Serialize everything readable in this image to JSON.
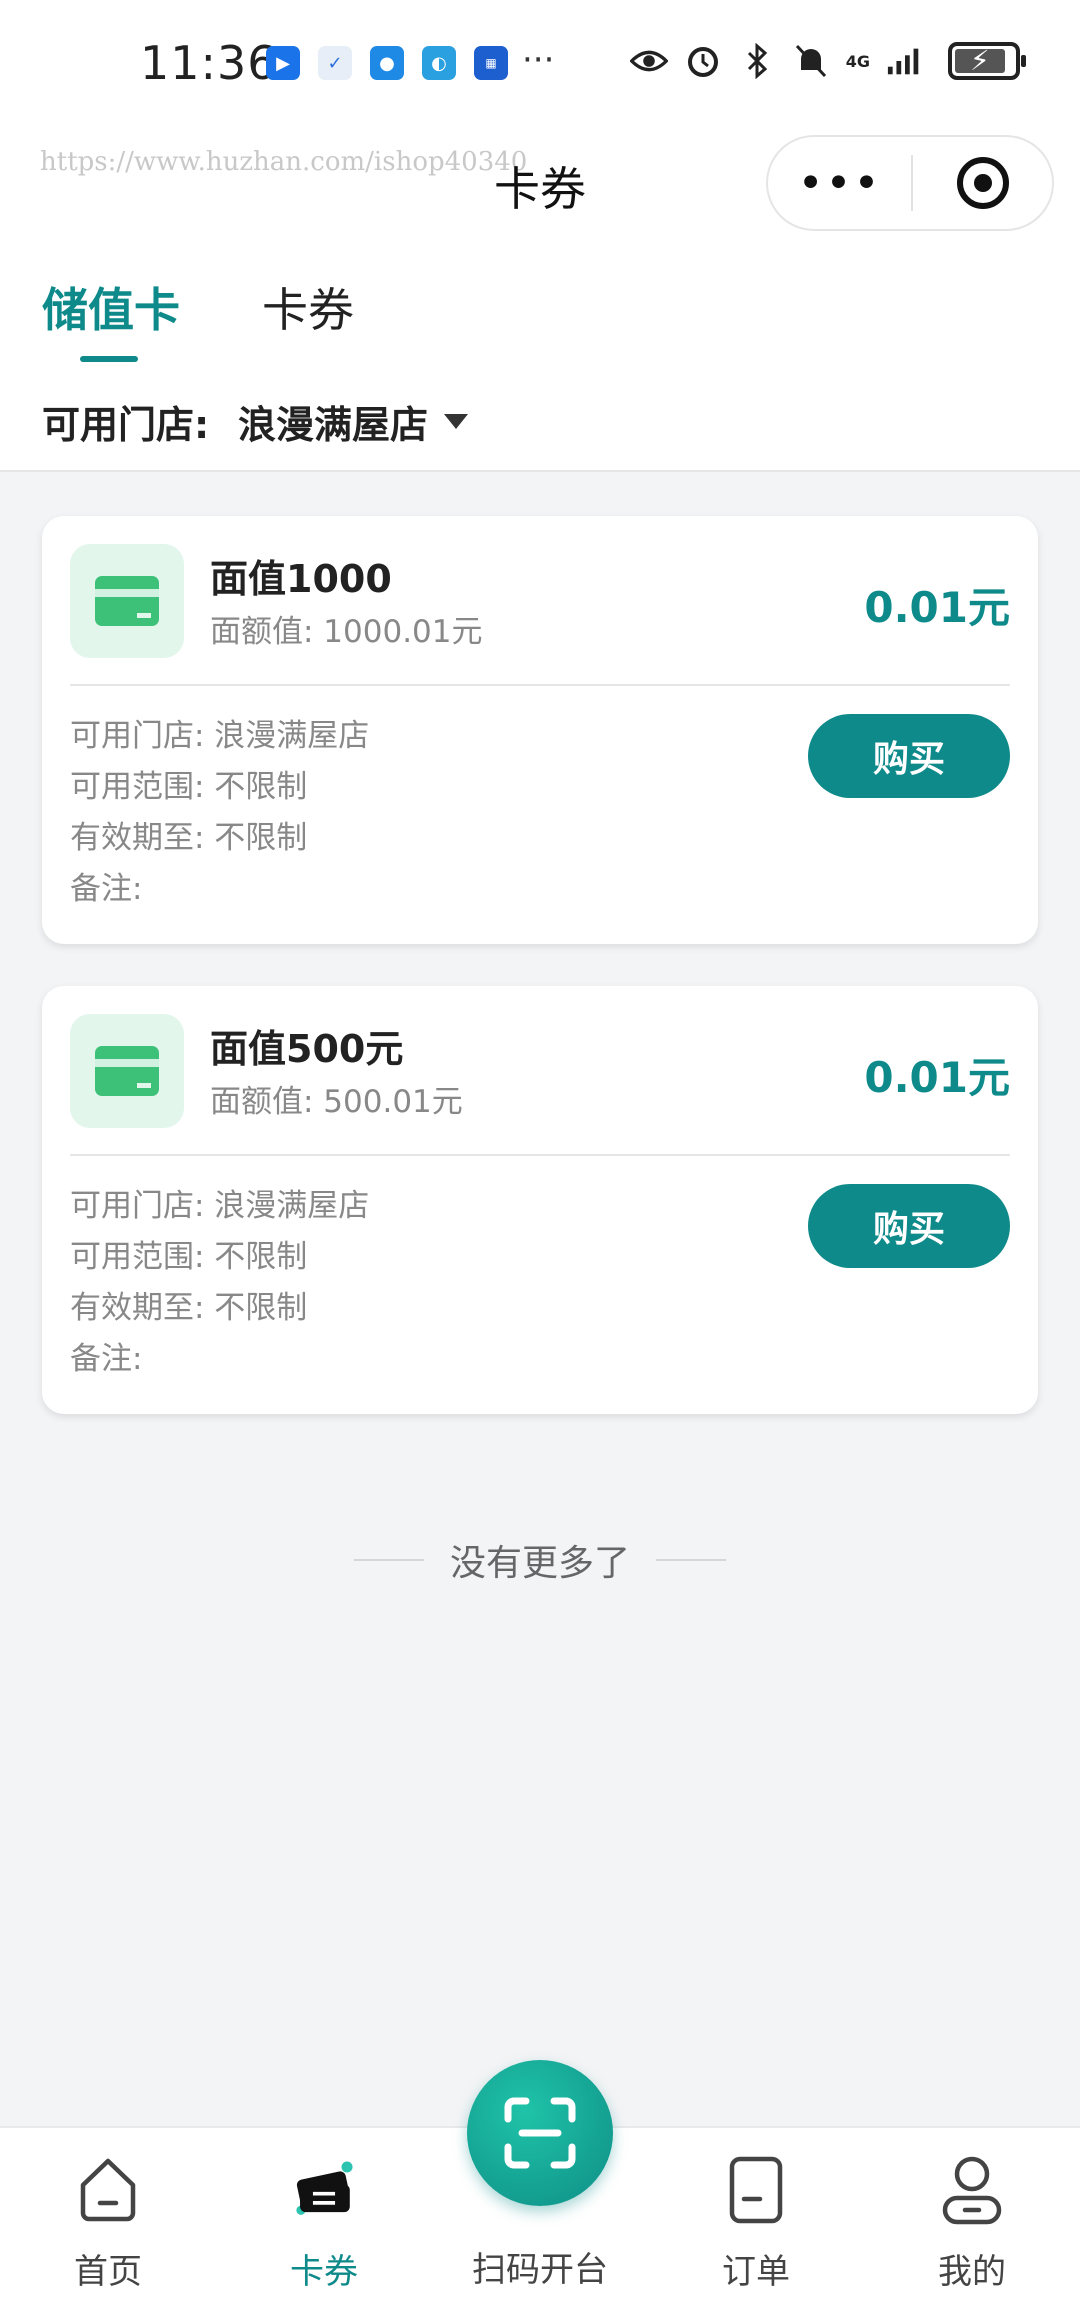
{
  "status_bar": {
    "time": "11:36",
    "more": "···",
    "network": "4G"
  },
  "header": {
    "watermark": "https://www.huzhan.com/ishop40340",
    "title": "卡券",
    "capsule_more": "•••"
  },
  "tabs": [
    {
      "label": "储值卡",
      "active": true
    },
    {
      "label": "卡券",
      "active": false
    }
  ],
  "store_filter": {
    "label": "可用门店:",
    "value": "浪漫满屋店"
  },
  "cards": [
    {
      "name": "面值1000",
      "face_value": "面额值: 1000.01元",
      "price": "0.01元",
      "store": "可用门店: 浪漫满屋店",
      "scope": "可用范围: 不限制",
      "expiry": "有效期至: 不限制",
      "note": "备注:",
      "buy_label": "购买"
    },
    {
      "name": "面值500元",
      "face_value": "面额值: 500.01元",
      "price": "0.01元",
      "store": "可用门店: 浪漫满屋店",
      "scope": "可用范围: 不限制",
      "expiry": "有效期至: 不限制",
      "note": "备注:",
      "buy_label": "购买"
    }
  ],
  "list_end": "没有更多了",
  "tabbar": {
    "home": "首页",
    "coupons": "卡券",
    "scan": "扫码开台",
    "orders": "订单",
    "mine": "我的"
  },
  "colors": {
    "accent": "#0f8a8a",
    "card_icon_bg": "#e2f6ec",
    "card_icon": "#3dc078"
  }
}
